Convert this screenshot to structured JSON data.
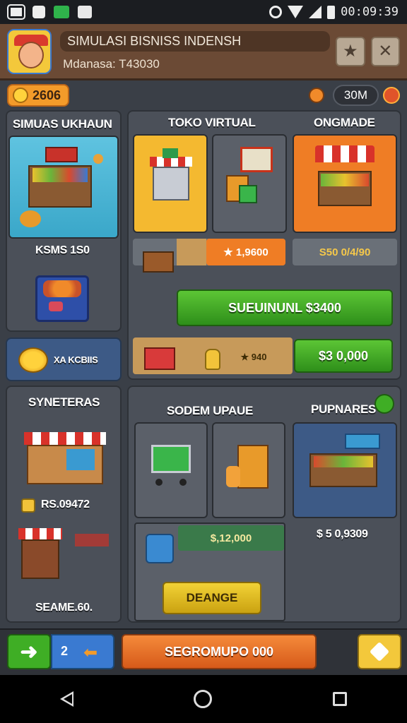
{
  "status_bar": {
    "time": "00:09:39",
    "icons": [
      "image-icon",
      "camera-icon",
      "chat-icon",
      "news-icon",
      "alarm-icon",
      "wifi-icon",
      "signal-icon",
      "battery-icon"
    ]
  },
  "header": {
    "title": "SIMULASI BISNISS INDENSH",
    "subtitle": "Mdanasa: T43030",
    "star_icon": "star-icon",
    "close_icon": "close-icon"
  },
  "resources": {
    "coins": "2606",
    "right_value": "30M"
  },
  "left_top_panel": {
    "title": "SIMUAS UKHAUN",
    "price_label": "KSMS 1S0"
  },
  "coin_row": {
    "label": "XA KCBIIS"
  },
  "virtual_panel": {
    "col1_title": "TOKO VIRTUAL",
    "col3_title": "ONGMADE",
    "bar1_value": "★ 1,9600",
    "bar2_value": "S50 0/4/90",
    "main_button": "SUEUINUNL $3400",
    "bar3_value": "★ 940",
    "buy_button": "$3 0,000"
  },
  "left_bottom_panel": {
    "title": "SYNETERAS",
    "price": "RS.09472",
    "footer": "SEAME.60."
  },
  "upgrade_panel": {
    "title1": "SODEM UPAUE",
    "title2": "PUPNARES",
    "price_right": "$ 5 0,9309",
    "bar_value": "$,12,000",
    "change_button": "DEANGE"
  },
  "bottom_bar": {
    "counter": "2",
    "main_button": "SEGROMUPO 000"
  },
  "colors": {
    "accent_orange": "#f39b2a",
    "green": "#3fae25",
    "panel": "#4b5059"
  }
}
